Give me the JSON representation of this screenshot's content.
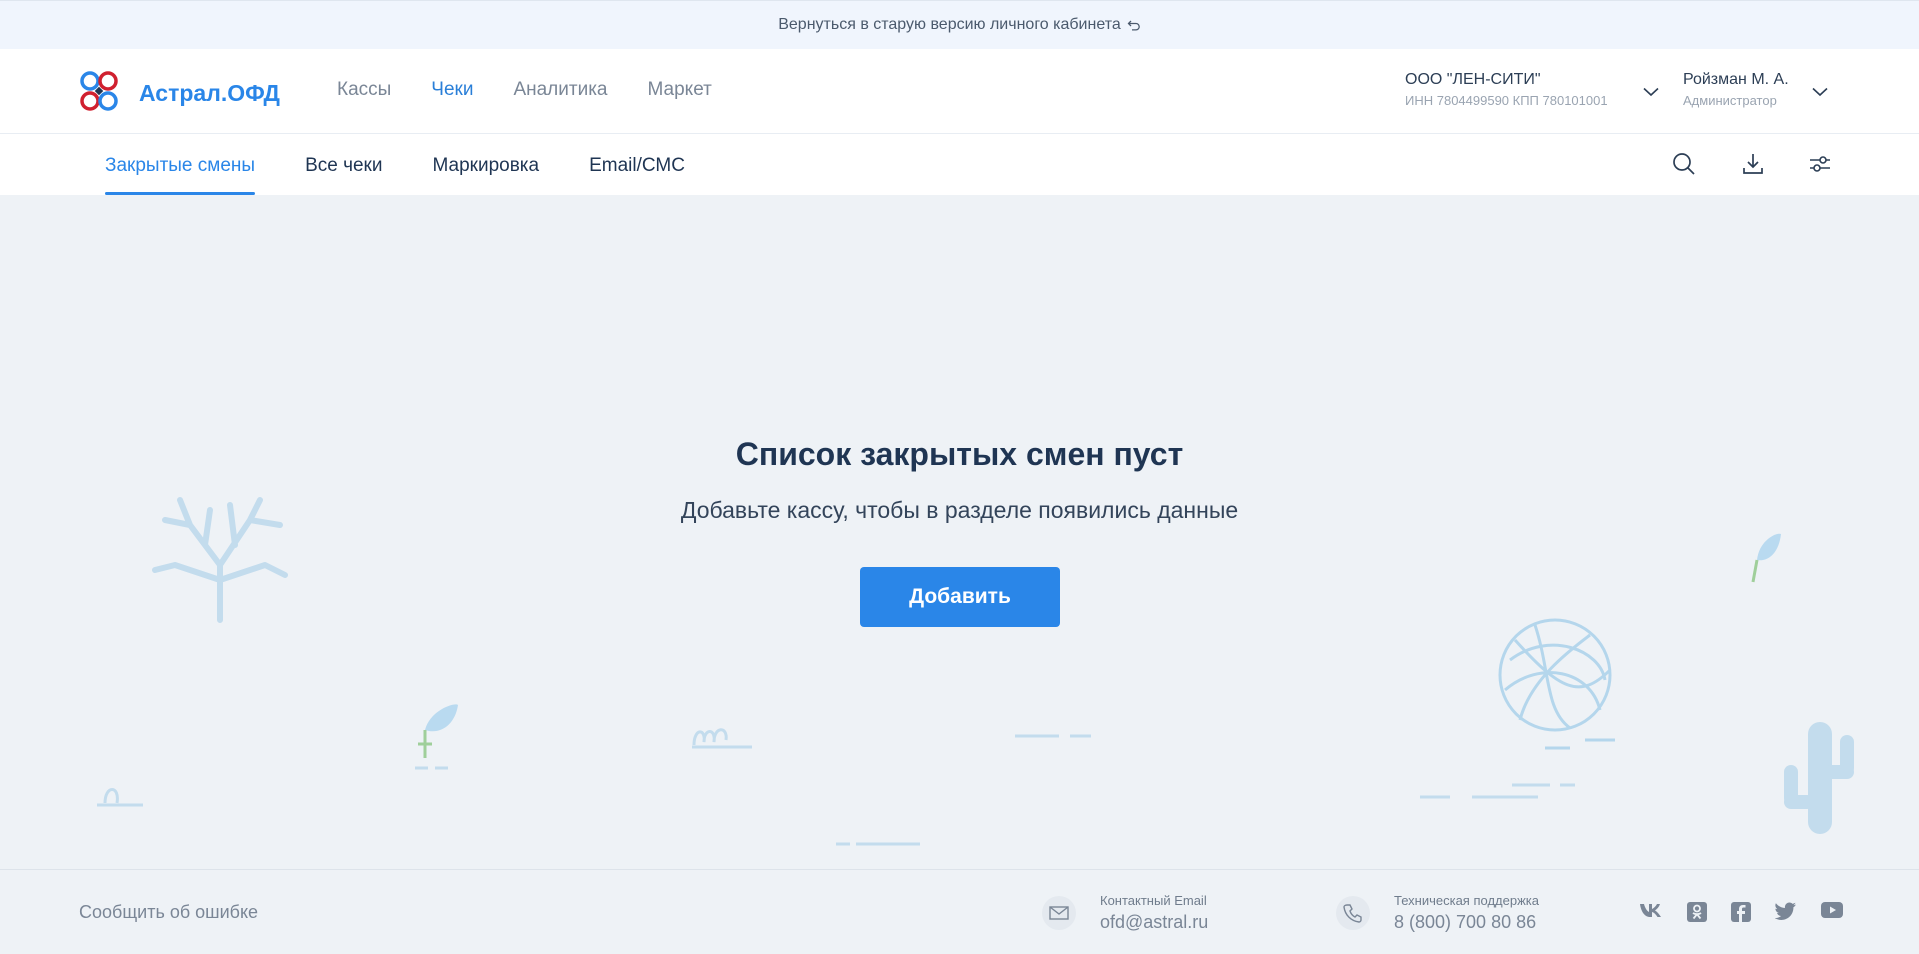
{
  "banner": {
    "text": "Вернуться в старую версию личного кабинета",
    "icon": "undo-arrow-icon"
  },
  "header": {
    "logo_text": "Астрал.ОФД",
    "nav": [
      {
        "label": "Кассы",
        "active": false
      },
      {
        "label": "Чеки",
        "active": true
      },
      {
        "label": "Аналитика",
        "active": false
      },
      {
        "label": "Маркет",
        "active": false
      }
    ],
    "org": {
      "name": "ООО \"ЛЕН-СИТИ\"",
      "details": "ИНН 7804499590  КПП 780101001"
    },
    "user": {
      "name": "Ройзман М. А.",
      "role": "Администратор"
    }
  },
  "subnav": {
    "tabs": [
      {
        "label": "Закрытые смены",
        "active": true
      },
      {
        "label": "Все чеки",
        "active": false
      },
      {
        "label": "Маркировка",
        "active": false
      },
      {
        "label": "Email/СМС",
        "active": false
      }
    ],
    "tools": [
      "search-icon",
      "download-icon",
      "filter-settings-icon"
    ]
  },
  "empty_state": {
    "title": "Список закрытых смен пуст",
    "subtitle": "Добавьте кассу, чтобы в разделе появились данные",
    "button": "Добавить"
  },
  "footer": {
    "report_link": "Сообщить об ошибке",
    "email_label": "Контактный Email",
    "email_value": "ofd@astral.ru",
    "support_label": "Техническая поддержка",
    "support_value": "8 (800) 700 80 86",
    "social": [
      "vk-icon",
      "odnoklassniki-icon",
      "facebook-icon",
      "twitter-icon",
      "youtube-icon"
    ]
  },
  "colors": {
    "accent": "#2a86e8",
    "text_dark": "#1f3553",
    "muted": "#7a8696",
    "background": "#eef2f6"
  }
}
